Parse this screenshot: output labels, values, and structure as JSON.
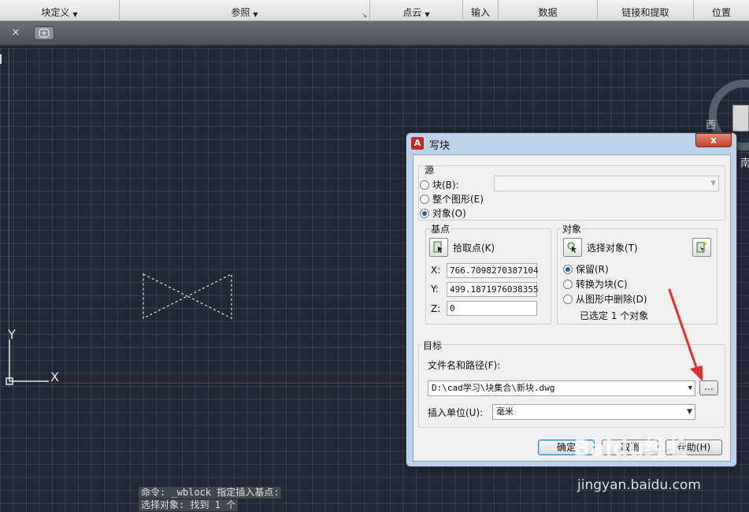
{
  "ribbon": {
    "panels": [
      {
        "label": "块定义",
        "has_dropdown": true
      },
      {
        "label": "参照",
        "has_dropdown": true
      },
      {
        "label": "点云",
        "has_dropdown": true
      },
      {
        "label": "输入",
        "has_dropdown": false
      },
      {
        "label": "数据",
        "has_dropdown": false
      },
      {
        "label": "链接和提取",
        "has_dropdown": false
      },
      {
        "label": "位置",
        "has_dropdown": false
      }
    ]
  },
  "tabs": {
    "close_glyph": "×",
    "new_tab_icon": "new-tab-icon"
  },
  "viewcube": {
    "west": "西",
    "south_edge": "南"
  },
  "ucs": {
    "y_label": "Y",
    "x_label": "X"
  },
  "command_line": {
    "line1": "命令: _wblock 指定插入基点:",
    "line2": "选择对象: 找到 1 个"
  },
  "dialog": {
    "title": "写块",
    "close_glyph": "x",
    "source": {
      "legend": "源",
      "block_label": "块(B):",
      "whole_drawing_label": "整个图形(E)",
      "objects_label": "对象(O)",
      "selected": "objects",
      "block_value": ""
    },
    "base_point": {
      "legend": "基点",
      "pick_label": "拾取点(K)",
      "x_label": "X:",
      "y_label": "Y:",
      "z_label": "Z:",
      "x_value": "766.7098270387104",
      "y_value": "499.1871976038355",
      "z_value": "0"
    },
    "objects": {
      "legend": "对象",
      "select_label": "选择对象(T)",
      "retain_label": "保留(R)",
      "convert_label": "转换为块(C)",
      "delete_label": "从图形中删除(D)",
      "selected_option": "retain",
      "status": "已选定 1 个对象"
    },
    "destination": {
      "legend": "目标",
      "path_label": "文件名和路径(F):",
      "path_value": "D:\\cad学习\\块集合\\新块.dwg",
      "browse_label": "...",
      "units_label": "插入单位(U):",
      "units_value": "毫米"
    },
    "buttons": {
      "ok": "确定",
      "cancel": "取消",
      "help": "帮助(H)"
    }
  },
  "watermark": {
    "brand": "Baidu经验",
    "url": "jingyan.baidu.com"
  },
  "colors": {
    "canvas": "#222834",
    "arrow": "#e5302a",
    "radio_accent": "#1f5fb0"
  }
}
